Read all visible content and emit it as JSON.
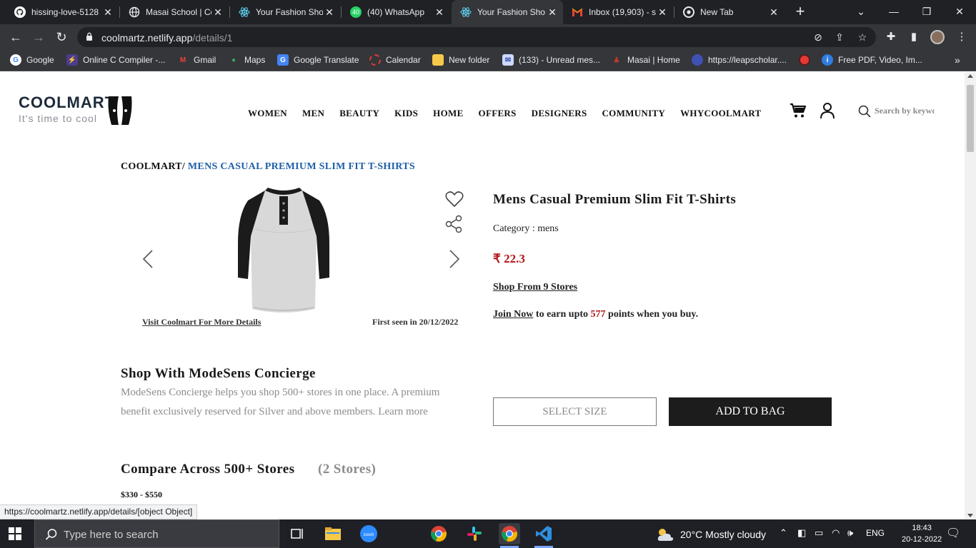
{
  "tabs": [
    {
      "title": "hissing-love-5128",
      "favicon": "github-icon",
      "color": "#ffffff"
    },
    {
      "title": "Masai School | Co",
      "favicon": "globe-icon",
      "color": "#9aa0a6"
    },
    {
      "title": "Your Fashion Sho",
      "favicon": "react-icon",
      "color": "#61dafb"
    },
    {
      "title": "(40) WhatsApp",
      "favicon": "whatsapp-icon",
      "color": "#25d366"
    },
    {
      "title": "Your Fashion Sho",
      "favicon": "react-icon",
      "color": "#61dafb",
      "active": true
    },
    {
      "title": "Inbox (19,903) - s",
      "favicon": "gmail-icon",
      "color": "#ea4335"
    },
    {
      "title": "New Tab",
      "favicon": "chrome-icon",
      "color": "#e8eaed"
    }
  ],
  "address": {
    "domain": "coolmartz.netlify.app",
    "path": "/details/1"
  },
  "bookmarks": [
    {
      "label": "Google",
      "icon": "google-icon",
      "color": "#4285f4"
    },
    {
      "label": "Online C Compiler -...",
      "icon": "compiler-icon",
      "color": "#7c4dff"
    },
    {
      "label": "Gmail",
      "icon": "gmail-icon",
      "color": "#ea4335"
    },
    {
      "label": "Maps",
      "icon": "maps-icon",
      "color": "#34a853"
    },
    {
      "label": "Google Translate",
      "icon": "translate-icon",
      "color": "#4285f4"
    },
    {
      "label": "Calendar",
      "icon": "calendar-icon",
      "color": "#e53935"
    },
    {
      "label": "New folder",
      "icon": "folder-icon",
      "color": "#f7c948"
    },
    {
      "label": "(133) - Unread mes...",
      "icon": "mail-icon",
      "color": "#6a8cff"
    },
    {
      "label": "Masai | Home",
      "icon": "masai-icon",
      "color": "#c0392b"
    },
    {
      "label": "https://leapscholar....",
      "icon": "leap-icon",
      "color": "#3f51b5"
    },
    {
      "label": "",
      "icon": "record-icon",
      "color": "#e53935"
    },
    {
      "label": "Free PDF, Video, Im...",
      "icon": "pdf-icon",
      "color": "#2f7de1"
    }
  ],
  "site": {
    "logo_word": "COOLMART",
    "logo_tagline": "It's time to cool",
    "nav": [
      "WOMEN",
      "MEN",
      "BEAUTY",
      "KIDS",
      "HOME",
      "OFFERS",
      "DESIGNERS",
      "COMMUNITY",
      "WHYCOOLMART"
    ],
    "search_placeholder": "Search by keyword"
  },
  "breadcrumb": {
    "root": "COOLMART/",
    "current": "MENS CASUAL PREMIUM SLIM FIT T-SHIRTS"
  },
  "gallery": {
    "visit_link": "Visit Coolmart For More Details",
    "first_seen": "First seen in 20/12/2022"
  },
  "product": {
    "title": "Mens Casual Premium Slim Fit T-Shirts",
    "category": "Category : mens",
    "price": "₹ 22.3",
    "shop_from": "Shop From 9 Stores",
    "join_now": "Join Now",
    "earn_text": " to earn upto ",
    "points": "577",
    "earn_suffix": " points when you buy."
  },
  "concierge": {
    "heading": "Shop With ModeSens Concierge",
    "body": "ModeSens Concierge helps you shop 500+ stores in one place. A premium benefit exclusively reserved for Silver and above members. Learn more"
  },
  "actions": {
    "select_size": "SELECT SIZE",
    "add_to_bag": "ADD TO BAG"
  },
  "compare": {
    "heading": "Compare Across 500+ Stores",
    "count": "(2 Stores)",
    "price_range": "$330 - $550"
  },
  "status_bar": "https://coolmartz.netlify.app/details/[object Object]",
  "taskbar": {
    "search_placeholder": "Type here to search",
    "weather": "20°C  Mostly cloudy",
    "lang": "ENG",
    "time": "18:43",
    "date": "20-12-2022"
  },
  "colors": {
    "accent_link": "#1f5fa8",
    "price_red": "#b01616",
    "button_dark": "#1c1c1c"
  }
}
